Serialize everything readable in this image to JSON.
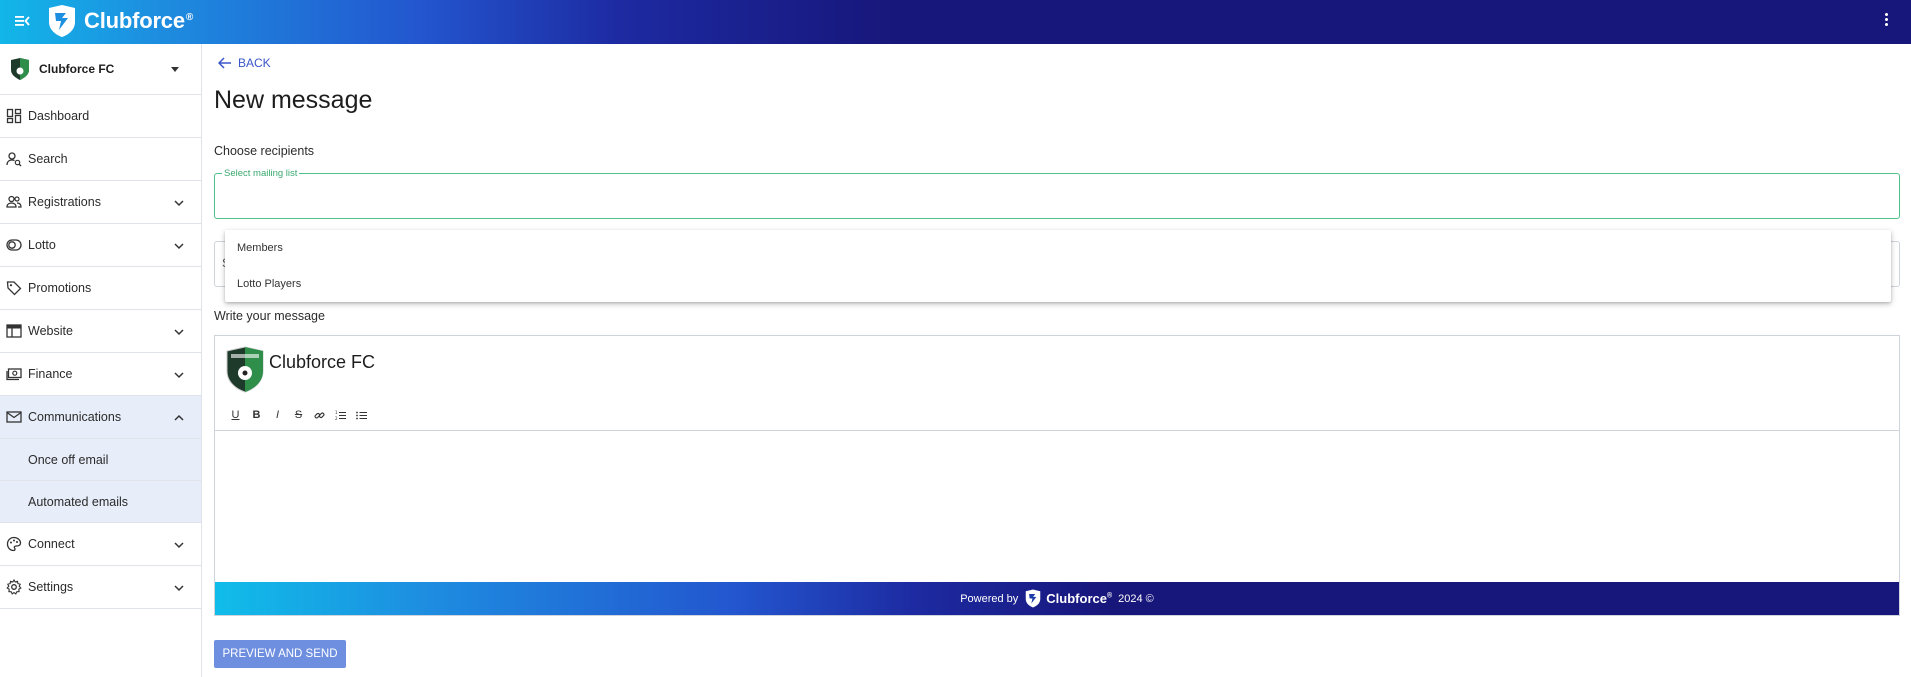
{
  "app": {
    "brand": "Clubforce",
    "brand_mark": "®",
    "colors": {
      "topbar_start": "#12b6e8",
      "topbar_end": "#17167a",
      "accent_green": "#4ec28a",
      "link_blue": "#3a56c9",
      "button_blue": "#6e8fe0"
    }
  },
  "sidebar": {
    "club_name": "Clubforce FC",
    "items": [
      {
        "label": "Dashboard",
        "icon": "dashboard-icon"
      },
      {
        "label": "Search",
        "icon": "person-search-icon"
      },
      {
        "label": "Registrations",
        "icon": "people-icon",
        "expandable": true
      },
      {
        "label": "Lotto",
        "icon": "toggle-icon",
        "expandable": true
      },
      {
        "label": "Promotions",
        "icon": "tag-icon"
      },
      {
        "label": "Website",
        "icon": "web-icon",
        "expandable": true
      },
      {
        "label": "Finance",
        "icon": "cash-icon",
        "expandable": true
      },
      {
        "label": "Communications",
        "icon": "mail-icon",
        "expandable": true,
        "expanded": true
      },
      {
        "label": "Connect",
        "icon": "palette-icon",
        "expandable": true
      },
      {
        "label": "Settings",
        "icon": "gear-icon",
        "expandable": true
      }
    ],
    "communications_sub": [
      "Once off email",
      "Automated emails"
    ]
  },
  "main": {
    "back_label": "BACK",
    "title": "New message",
    "recipients_label": "Choose recipients",
    "mailing_list_label": "Select mailing list",
    "mailing_list_options": [
      "Members",
      "Lotto Players"
    ],
    "message_label": "Write your message",
    "hidden_field_peek": "S",
    "editor": {
      "club_name": "Clubforce FC",
      "toolbar": [
        {
          "label": "U",
          "icon": "underline-icon"
        },
        {
          "label": "B",
          "icon": "bold-icon"
        },
        {
          "label": "I",
          "icon": "italic-icon"
        },
        {
          "label": "S",
          "icon": "strikethrough-icon"
        },
        {
          "label": "",
          "icon": "link-icon"
        },
        {
          "label": "",
          "icon": "ordered-list-icon"
        },
        {
          "label": "",
          "icon": "bullet-list-icon"
        }
      ],
      "footer_powered": "Powered by",
      "footer_brand": "Clubforce",
      "footer_reg": "®",
      "footer_year": "2024 ©"
    },
    "preview_button": "PREVIEW AND SEND"
  }
}
